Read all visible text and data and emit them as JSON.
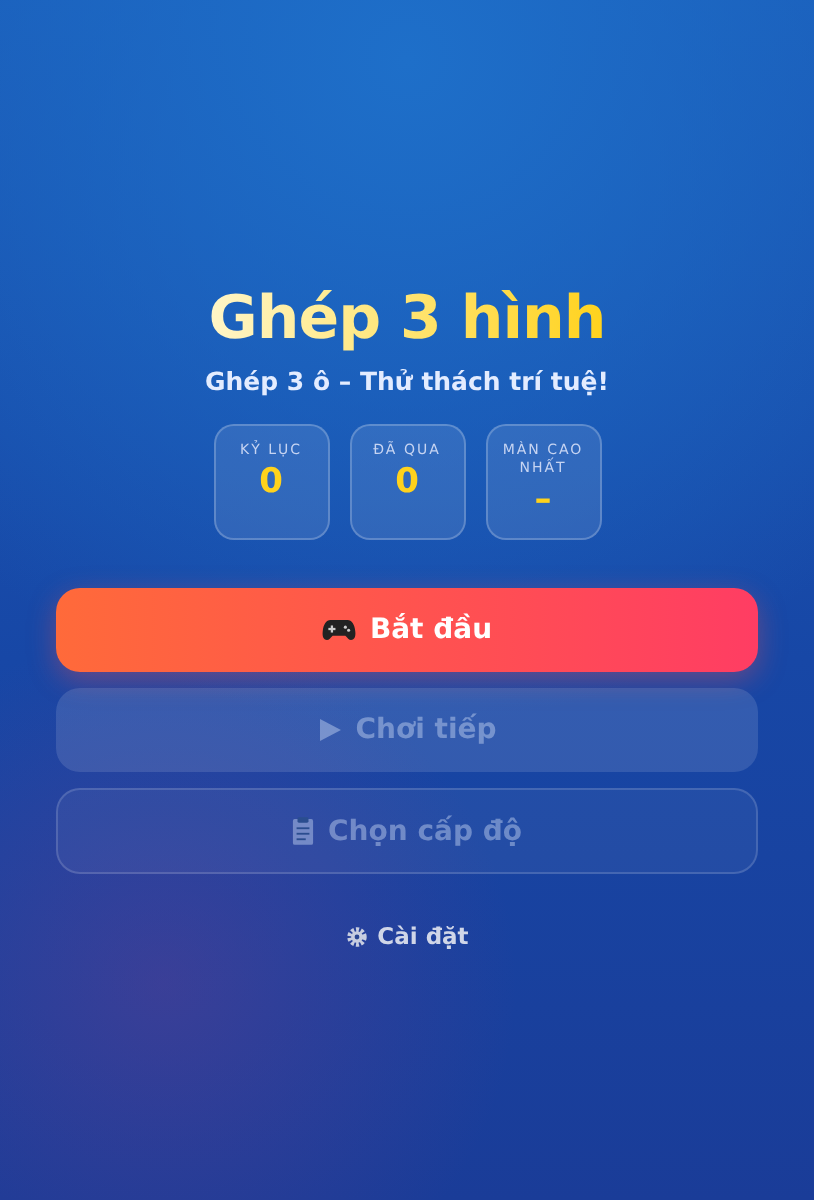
{
  "title": "Ghép 3 hình",
  "subtitle": "Ghép 3 ô – Thử thách trí tuệ!",
  "stats": [
    {
      "label": "KỶ LỤC",
      "value": "0"
    },
    {
      "label": "ĐÃ QUA",
      "value": "0"
    },
    {
      "label": "MÀN CAO NHẤT",
      "value": "–"
    }
  ],
  "buttons": [
    {
      "label": "Bắt đầu",
      "kind": "primary",
      "disabled": false
    },
    {
      "label": "Chơi tiếp",
      "kind": "secondary",
      "disabled": true
    },
    {
      "label": "Chọn cấp độ",
      "kind": "outline",
      "disabled": true
    }
  ],
  "settings_link": "Cài đặt"
}
